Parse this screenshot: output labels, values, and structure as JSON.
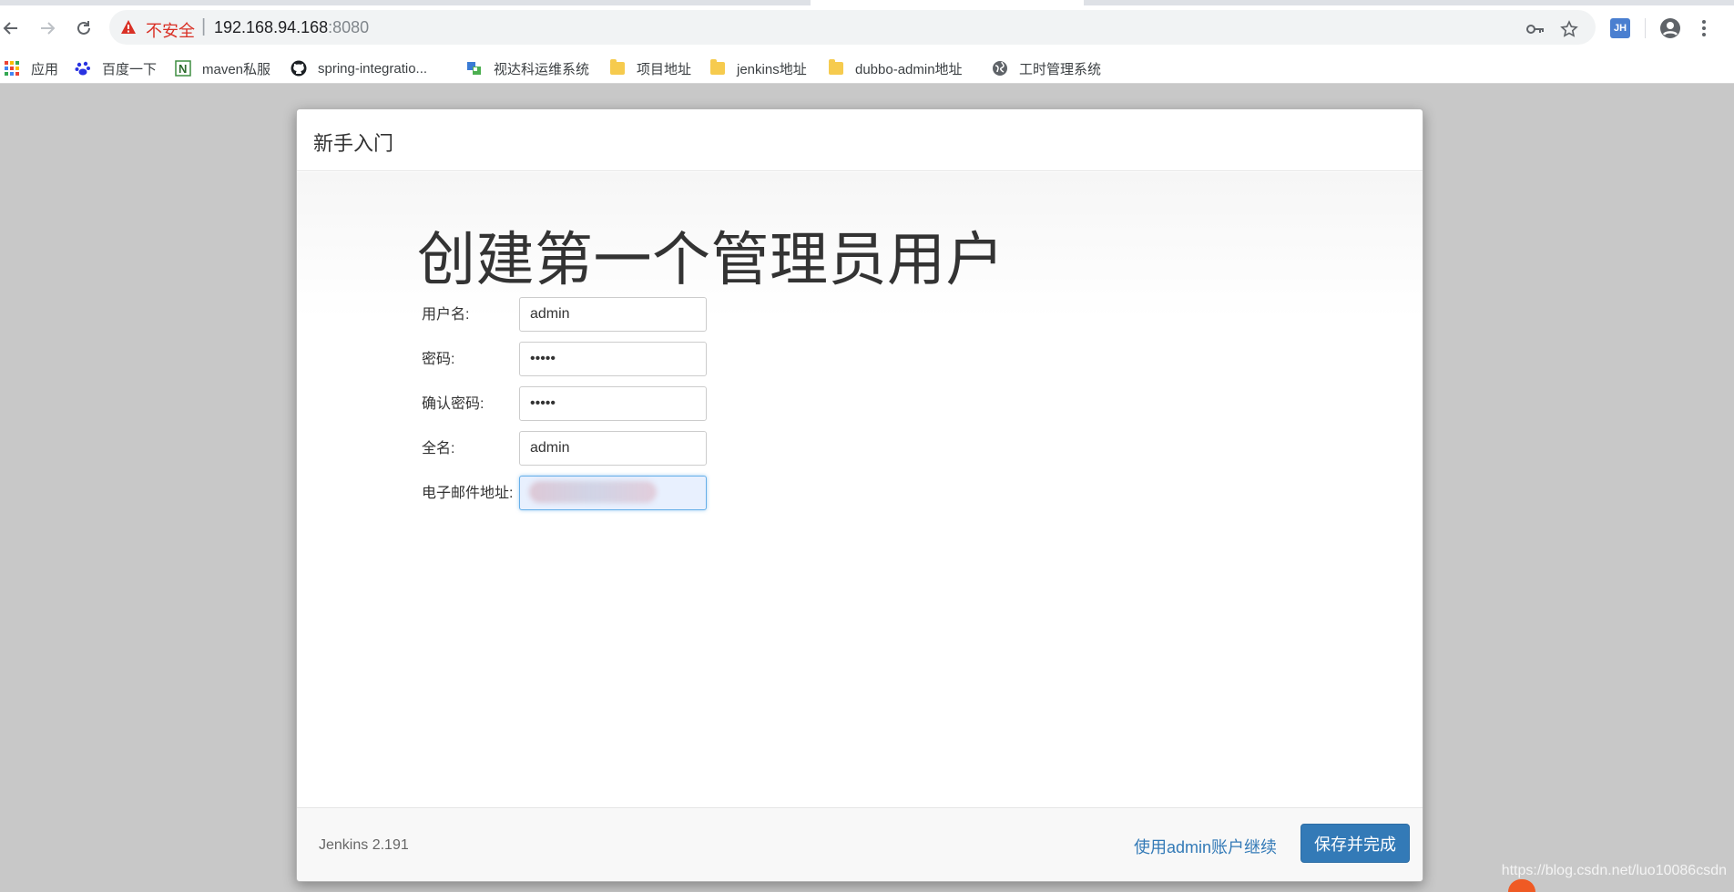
{
  "browser": {
    "nav": {
      "back_icon": "arrow-left-icon",
      "forward_icon": "arrow-right-icon",
      "reload_icon": "reload-icon"
    },
    "omnibox": {
      "security_text": "不安全",
      "separator": "|",
      "url_host": "192.168.94.168",
      "url_port": ":8080",
      "key_icon": "key-icon",
      "star_icon": "star-icon"
    },
    "extension_label": "JH",
    "profile_icon": "account-circle-icon",
    "menu_icon": "more-vert-icon"
  },
  "bookmarks": [
    {
      "label": "应用",
      "icon": "apps-grid-icon"
    },
    {
      "label": "百度一下",
      "icon": "baidu-paw-icon"
    },
    {
      "label": "maven私服",
      "icon": "nexus-icon"
    },
    {
      "label": "spring-integratio...",
      "icon": "github-icon"
    },
    {
      "label": "视达科运维系统",
      "icon": "ops-system-icon"
    },
    {
      "label": "项目地址",
      "icon": "folder-icon"
    },
    {
      "label": "jenkins地址",
      "icon": "folder-icon"
    },
    {
      "label": "dubbo-admin地址",
      "icon": "folder-icon"
    },
    {
      "label": "工时管理系统",
      "icon": "globe-icon"
    }
  ],
  "dialog": {
    "title": "新手入门",
    "heading": "创建第一个管理员用户",
    "fields": {
      "username": {
        "label": "用户名:",
        "value": "admin"
      },
      "password": {
        "label": "密码:",
        "value": "admin"
      },
      "confirm_password": {
        "label": "确认密码:",
        "value": "admin"
      },
      "full_name": {
        "label": "全名:",
        "value": "admin"
      },
      "email": {
        "label": "电子邮件地址:",
        "value": ""
      }
    },
    "footer": {
      "version": "Jenkins 2.191",
      "continue_link": "使用admin账户继续",
      "save_button": "保存并完成"
    }
  },
  "watermark": "https://blog.csdn.net/luo10086csdn",
  "colors": {
    "primary": "#337ab7",
    "warning": "#d93025",
    "backdrop": "#c8c8c8"
  }
}
